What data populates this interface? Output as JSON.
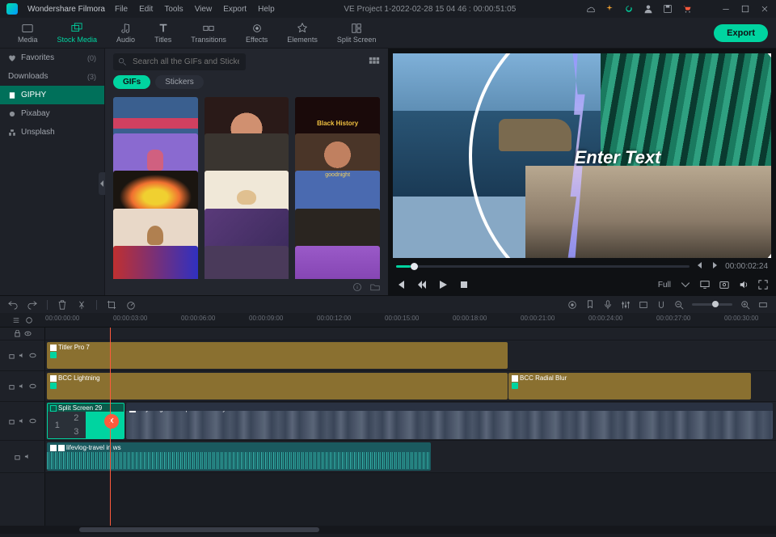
{
  "titlebar": {
    "app_name": "Wondershare Filmora",
    "menu": [
      "File",
      "Edit",
      "Tools",
      "View",
      "Export",
      "Help"
    ],
    "project_title": "VE Project 1-2022-02-28 15 04 46 : 00:00:51:05"
  },
  "toolbar": {
    "tabs": [
      {
        "id": "media",
        "label": "Media"
      },
      {
        "id": "stock",
        "label": "Stock Media"
      },
      {
        "id": "audio",
        "label": "Audio"
      },
      {
        "id": "titles",
        "label": "Titles"
      },
      {
        "id": "transitions",
        "label": "Transitions"
      },
      {
        "id": "effects",
        "label": "Effects"
      },
      {
        "id": "elements",
        "label": "Elements"
      },
      {
        "id": "split",
        "label": "Split Screen"
      }
    ],
    "export_label": "Export"
  },
  "sidebar": {
    "items": [
      {
        "id": "favorites",
        "label": "Favorites",
        "count": "(0)"
      },
      {
        "id": "downloads",
        "label": "Downloads",
        "count": "(3)"
      },
      {
        "id": "giphy",
        "label": "GIPHY",
        "count": ""
      },
      {
        "id": "pixabay",
        "label": "Pixabay",
        "count": ""
      },
      {
        "id": "unsplash",
        "label": "Unsplash",
        "count": ""
      }
    ]
  },
  "search": {
    "placeholder": "Search all the GIFs and Stickers"
  },
  "filters": {
    "gifs": "GIFs",
    "stickers": "Stickers"
  },
  "thumbs": {
    "t2_text": "Black History",
    "t8_text": "goodnight"
  },
  "preview": {
    "overlay_text": "Enter Text",
    "timecode": "00:00:02:24",
    "quality": "Full"
  },
  "ruler": {
    "ticks": [
      "00:00:00:00",
      "00:00:03:00",
      "00:00:06:00",
      "00:00:09:00",
      "00:00:12:00",
      "00:00:15:00",
      "00:00:18:00",
      "00:00:21:00",
      "00:00:24:00",
      "00:00:27:00",
      "00:00:30:00"
    ]
  },
  "clips": {
    "titler": "Titler Pro 7",
    "lightning": "BCC Lightning",
    "radial": "BCC Radial Blur",
    "split": "Split Screen 29",
    "video": "DaytonighttimelapseofPariscityFrance",
    "audio": "lifevlog-travel in ws",
    "split_nums": {
      "n1": "1",
      "n2": "2",
      "n3": "3"
    }
  }
}
